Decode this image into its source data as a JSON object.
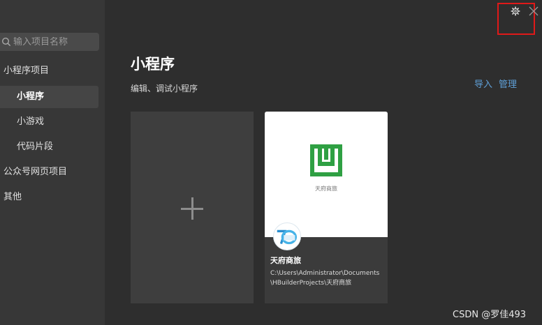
{
  "search": {
    "placeholder": "输入项目名称"
  },
  "sidebar": {
    "items": [
      {
        "label": "小程序项目"
      },
      {
        "label": "小程序"
      },
      {
        "label": "小游戏"
      },
      {
        "label": "代码片段"
      },
      {
        "label": "公众号网页项目"
      },
      {
        "label": "其他"
      }
    ]
  },
  "header": {
    "title": "小程序",
    "subtitle": "编辑、调试小程序",
    "import_label": "导入",
    "manage_label": "管理"
  },
  "project": {
    "logo_caption": "天府商旅",
    "name": "天府商旅",
    "path": "C:\\Users\\Administrator\\Documents\\HBuilderProjects\\天府商旅"
  },
  "watermark": "CSDN @罗佳493",
  "colors": {
    "accent_link": "#5fa0d8",
    "logo_green": "#2fa043",
    "highlight_red": "#e01919"
  }
}
